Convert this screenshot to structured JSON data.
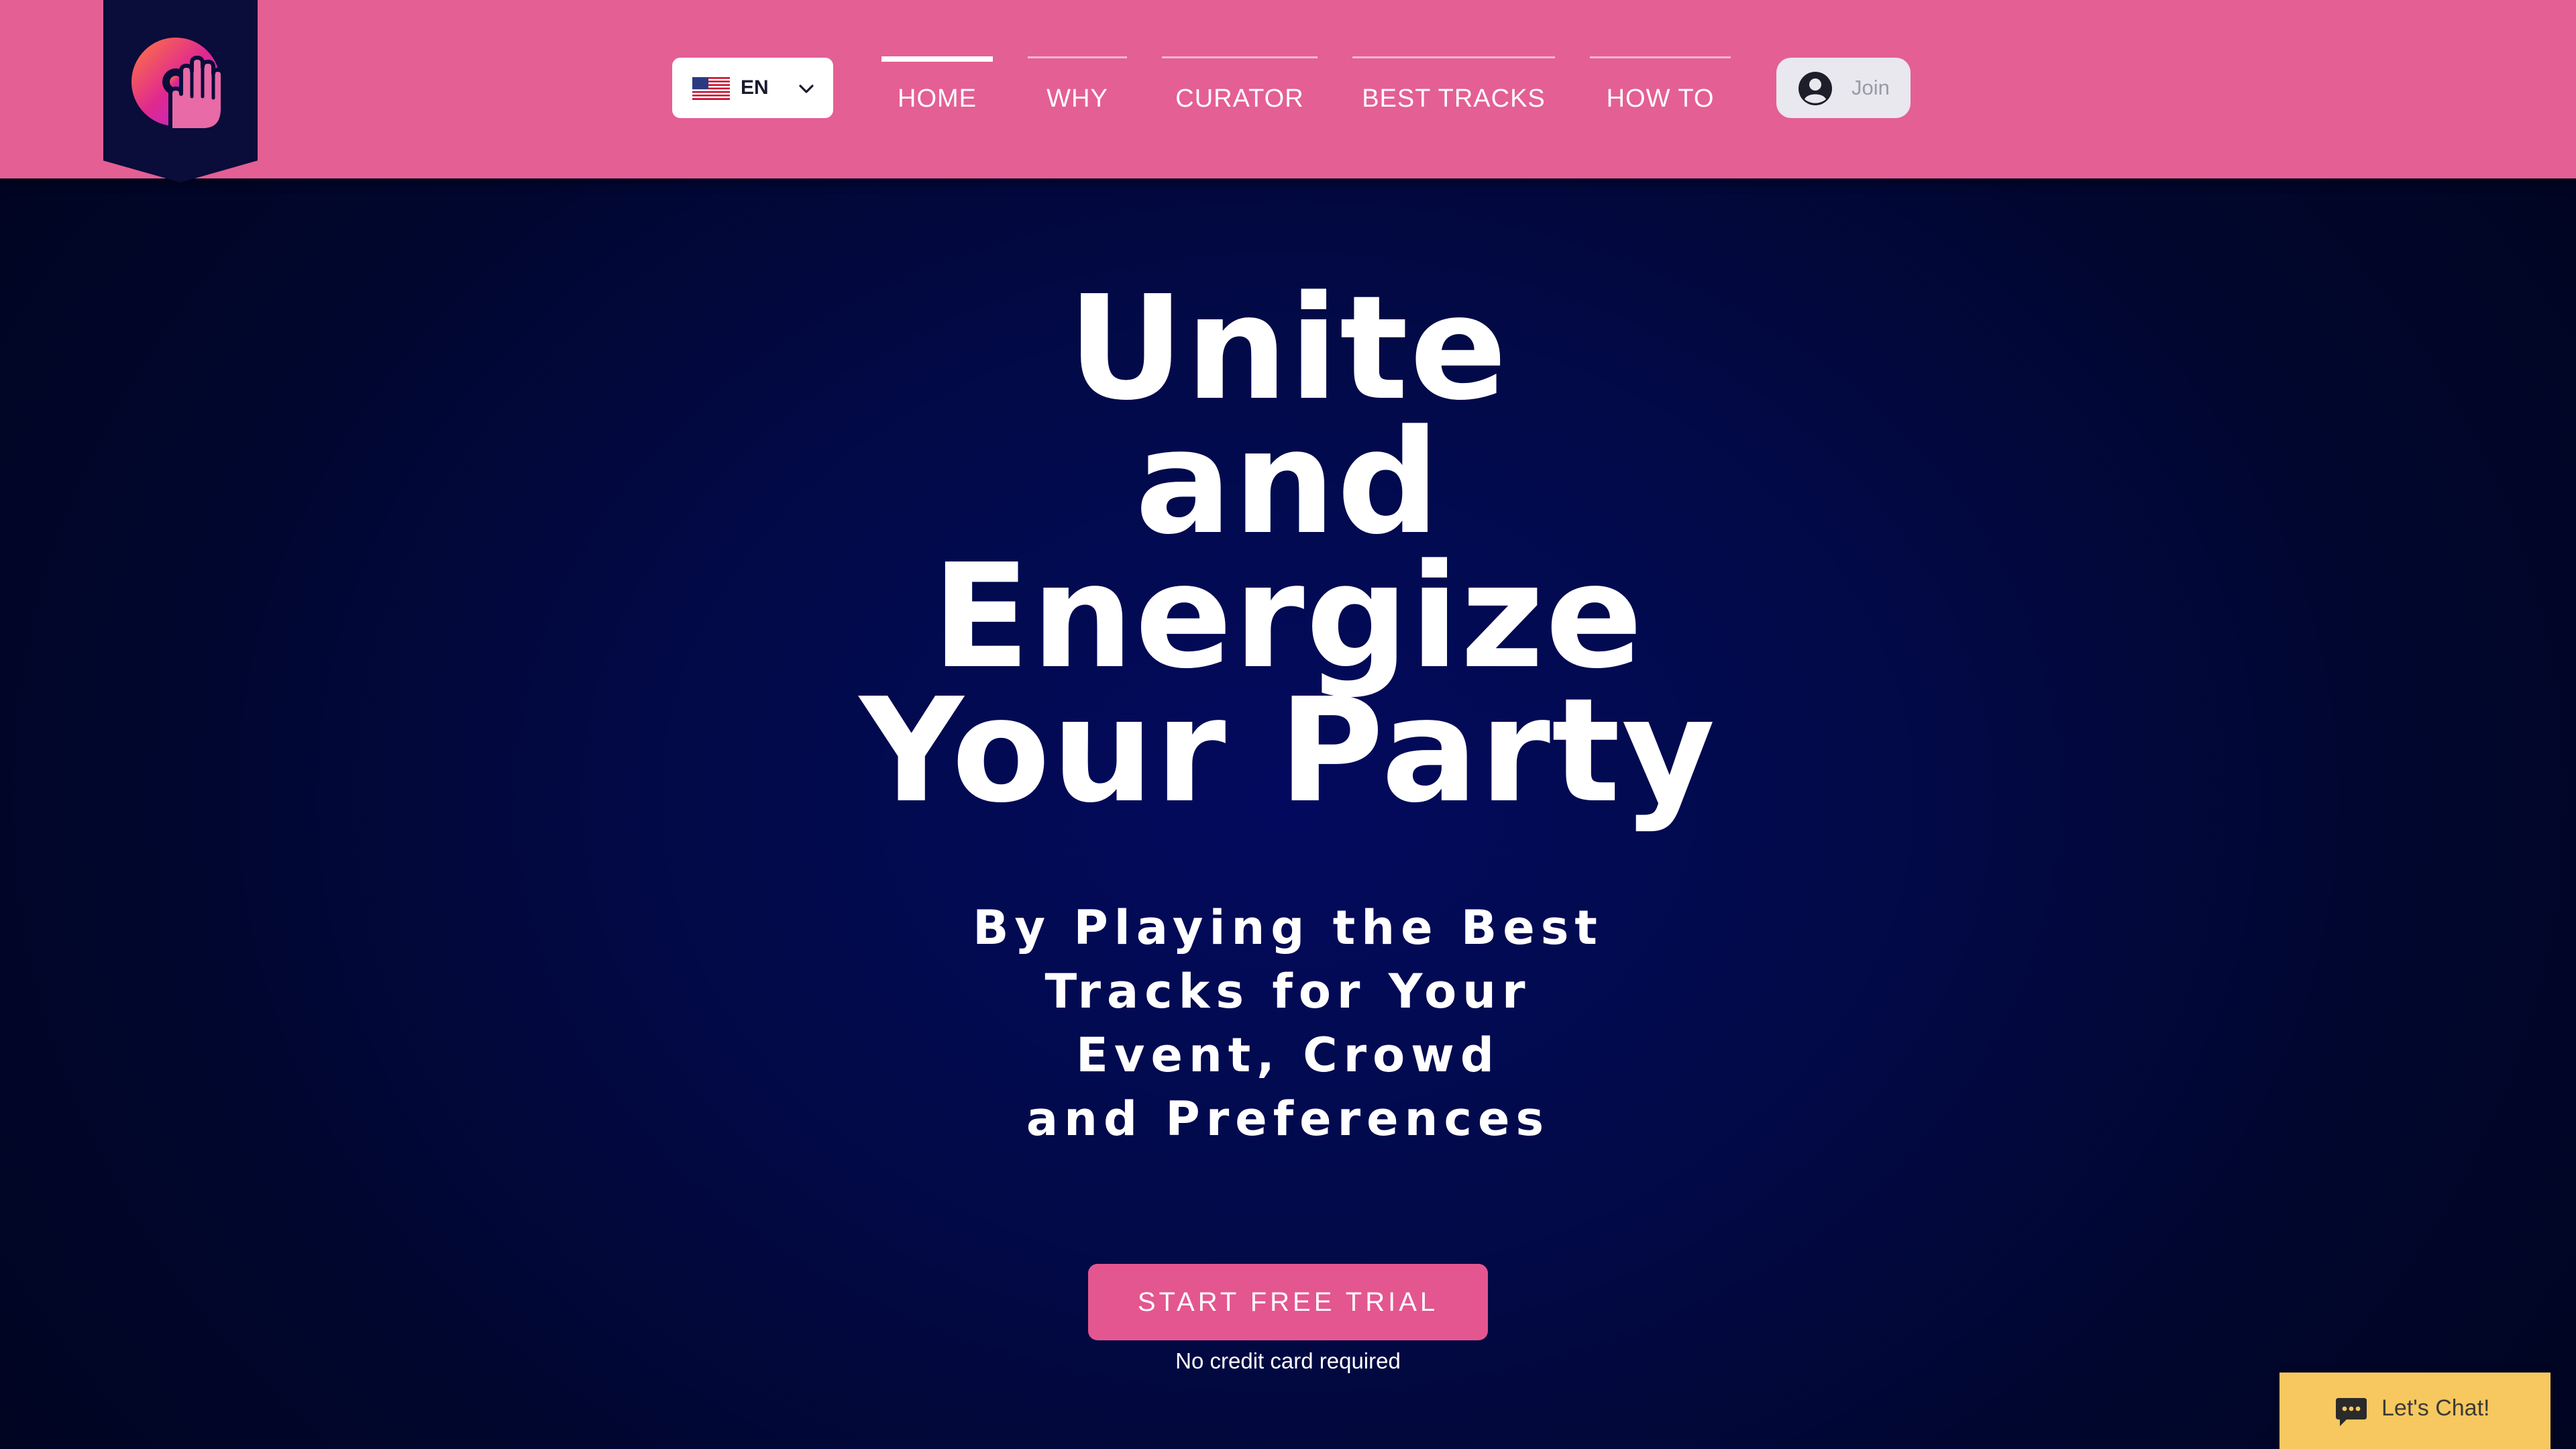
{
  "header": {
    "logo": {
      "icon": "dj-hand-logo-icon"
    },
    "language": {
      "flag": "us-flag-icon",
      "code": "EN",
      "chevron": "chevron-down-icon"
    },
    "nav": [
      {
        "label": "HOME",
        "active": true
      },
      {
        "label": "WHY",
        "active": false
      },
      {
        "label": "CURATOR",
        "active": false
      },
      {
        "label": "BEST TRACKS",
        "active": false
      },
      {
        "label": "HOW TO",
        "active": false
      }
    ],
    "join": {
      "icon": "account-icon",
      "label": "Join"
    }
  },
  "hero": {
    "title_lines": [
      "Unite",
      "and",
      "Energize",
      "Your Party"
    ],
    "subtitle_lines": [
      "By Playing the Best",
      "Tracks for Your",
      "Event, Crowd",
      "and Preferences"
    ],
    "cta_label": "START FREE TRIAL",
    "cta_note": "No credit card required"
  },
  "chat": {
    "icon": "chat-bubble-icon",
    "label": "Let's Chat!"
  },
  "colors": {
    "header": "#e45f94",
    "logo_ribbon": "#0a0c3a",
    "background": "#020a4a",
    "cta": "#e4568f",
    "chat": "#f6c85f"
  }
}
